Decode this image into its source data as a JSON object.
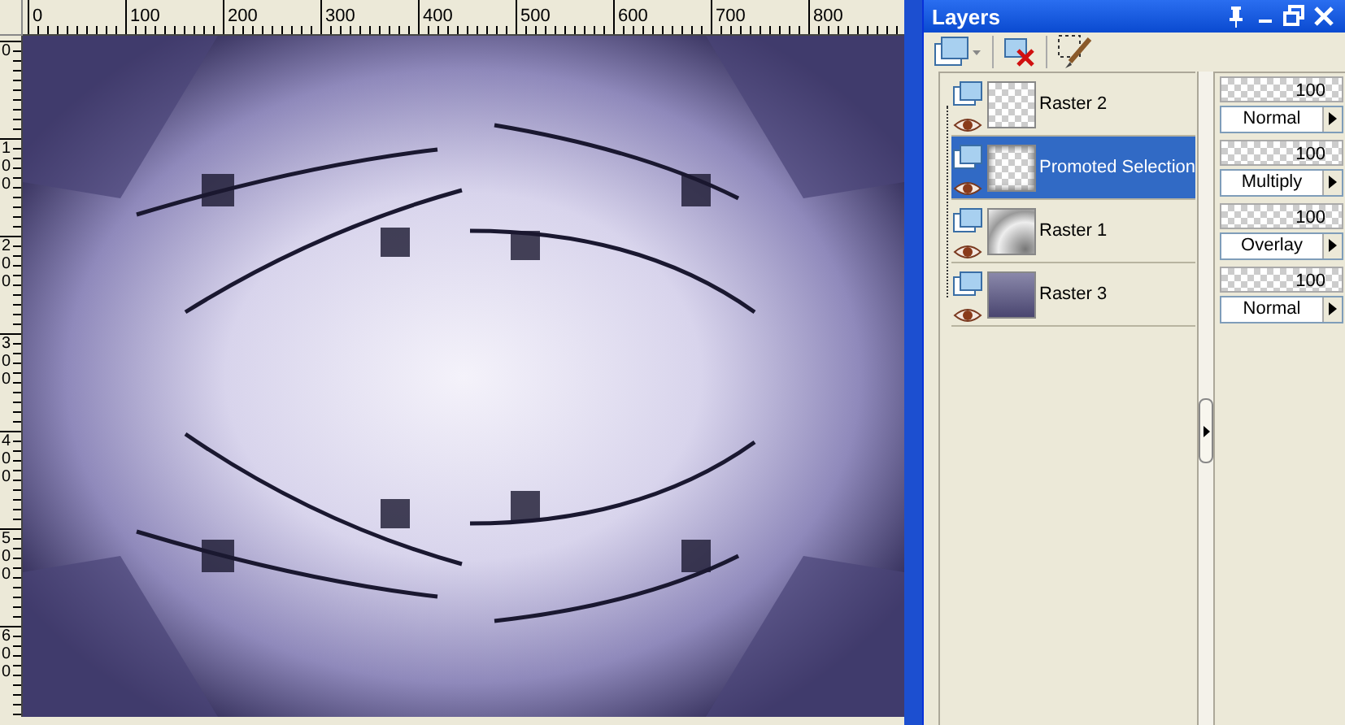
{
  "rulers": {
    "horizontal": [
      "0",
      "100",
      "200",
      "300",
      "400",
      "500",
      "600",
      "700",
      "800"
    ],
    "vertical": [
      "0",
      "100",
      "200",
      "300",
      "400",
      "500",
      "600"
    ]
  },
  "layers_palette": {
    "title": "Layers",
    "layers": [
      {
        "name": "Raster 2",
        "selected": false,
        "kind": "pattern",
        "opacity": "100",
        "blend_mode": "Normal"
      },
      {
        "name": "Promoted Selection",
        "selected": true,
        "kind": "selection",
        "opacity": "100",
        "blend_mode": "Multiply"
      },
      {
        "name": "Raster 1",
        "selected": false,
        "kind": "light",
        "opacity": "100",
        "blend_mode": "Overlay"
      },
      {
        "name": "Raster 3",
        "selected": false,
        "kind": "dark",
        "opacity": "100",
        "blend_mode": "Normal"
      }
    ]
  }
}
